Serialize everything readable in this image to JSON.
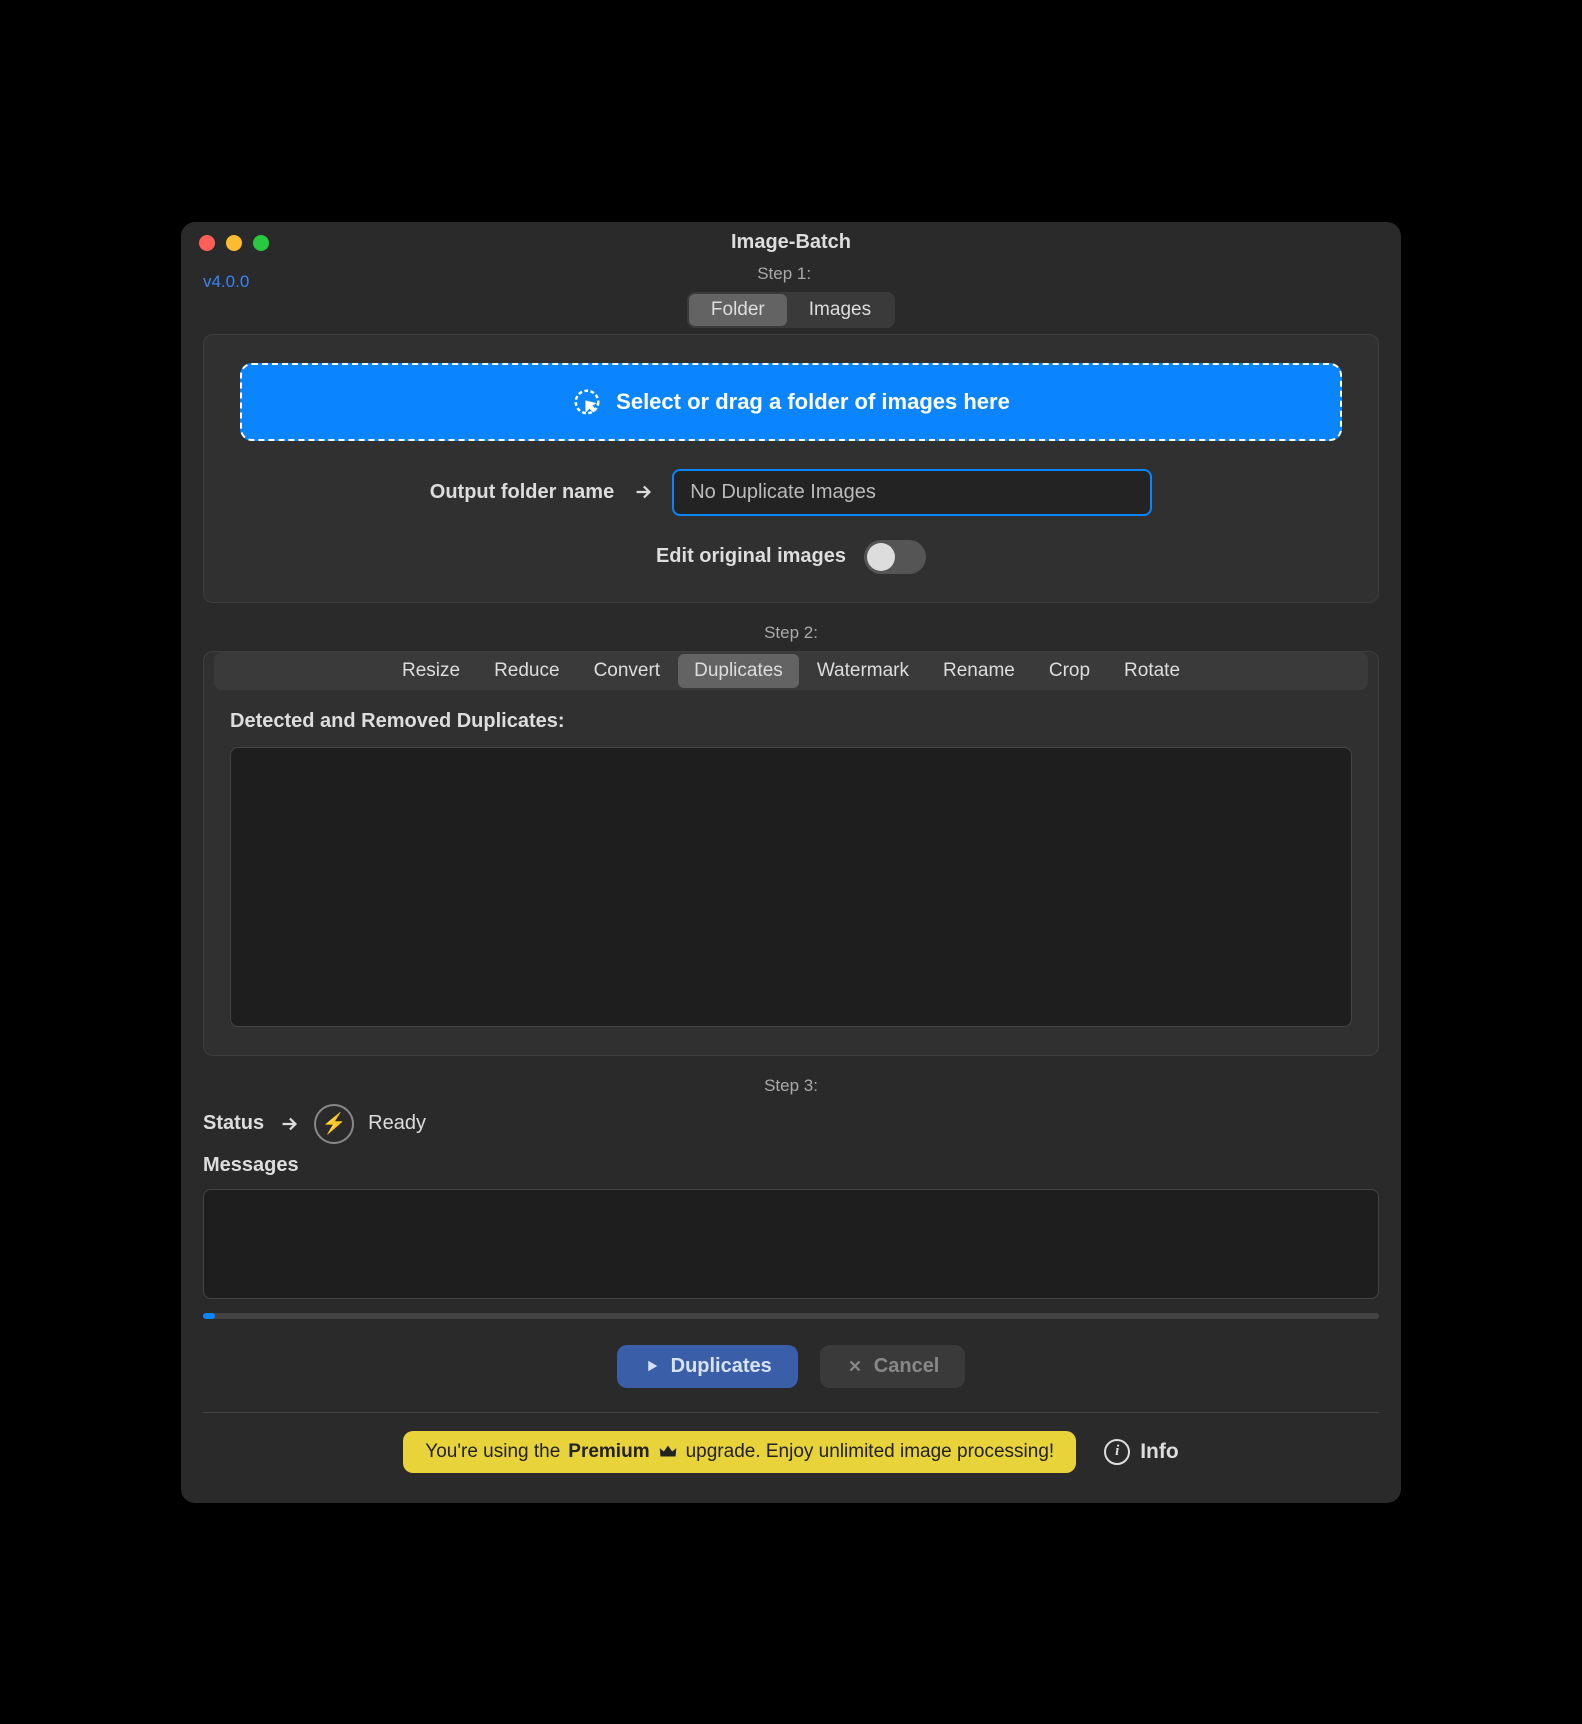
{
  "window": {
    "title": "Image-Batch",
    "version": "v4.0.0"
  },
  "step1": {
    "label": "Step 1:",
    "source_tabs": [
      "Folder",
      "Images"
    ],
    "source_active": "Folder",
    "dropzone_text": "Select or drag a folder of images here",
    "output_label": "Output folder name",
    "output_value": "No Duplicate Images",
    "edit_original_label": "Edit original images",
    "edit_original_on": false
  },
  "step2": {
    "label": "Step 2:",
    "tabs": [
      "Resize",
      "Reduce",
      "Convert",
      "Duplicates",
      "Watermark",
      "Rename",
      "Crop",
      "Rotate"
    ],
    "active_tab": "Duplicates",
    "duplicates_heading": "Detected and Removed Duplicates:"
  },
  "step3": {
    "label": "Step 3:",
    "status_label": "Status",
    "status_text": "Ready",
    "messages_label": "Messages"
  },
  "actions": {
    "primary": "Duplicates",
    "cancel": "Cancel"
  },
  "banner": {
    "text_before": "You're using the ",
    "premium_word": "Premium",
    "text_after": " upgrade. Enjoy unlimited image processing!"
  },
  "info_label": "Info"
}
